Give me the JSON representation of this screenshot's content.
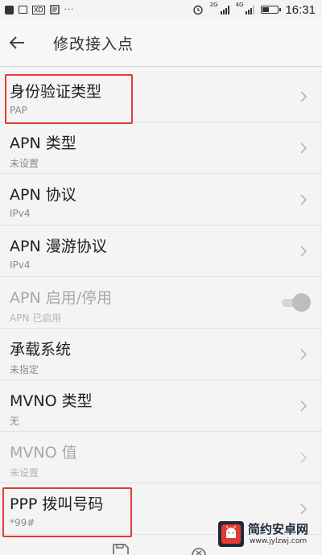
{
  "status_bar": {
    "time": "16:31",
    "signal_label_1": "2G",
    "signal_label_2": "4G",
    "dots": "···"
  },
  "header": {
    "title": "修改接入点",
    "back_icon": "arrow-left-icon"
  },
  "settings": [
    {
      "title": "身份验证类型",
      "value": "PAP",
      "control": "chevron",
      "enabled": true,
      "highlighted": true
    },
    {
      "title": "APN 类型",
      "value": "未设置",
      "control": "chevron",
      "enabled": true
    },
    {
      "title": "APN 协议",
      "value": "IPv4",
      "control": "chevron",
      "enabled": true
    },
    {
      "title": "APN 漫游协议",
      "value": "IPv4",
      "control": "chevron",
      "enabled": true
    },
    {
      "title": "APN 启用/停用",
      "value": "APN 已启用",
      "control": "toggle",
      "enabled": false
    },
    {
      "title": "承载系统",
      "value": "未指定",
      "control": "chevron",
      "enabled": true
    },
    {
      "title": "MVNO 类型",
      "value": "无",
      "control": "chevron",
      "enabled": true
    },
    {
      "title": "MVNO 值",
      "value": "未设置",
      "control": "chevron",
      "enabled": false
    },
    {
      "title": "PPP 拨叫号码",
      "value": "*99#",
      "control": "chevron",
      "enabled": true,
      "highlighted": true
    }
  ],
  "bottom_bar": {
    "icons": [
      "save-icon",
      "cancel-icon"
    ]
  },
  "watermark": {
    "title": "简约安卓网",
    "url": "www.jylzwj.com"
  },
  "colors": {
    "highlight": "#e53935",
    "background": "#f4f4f4",
    "disabled_text": "#a8a8a8"
  }
}
